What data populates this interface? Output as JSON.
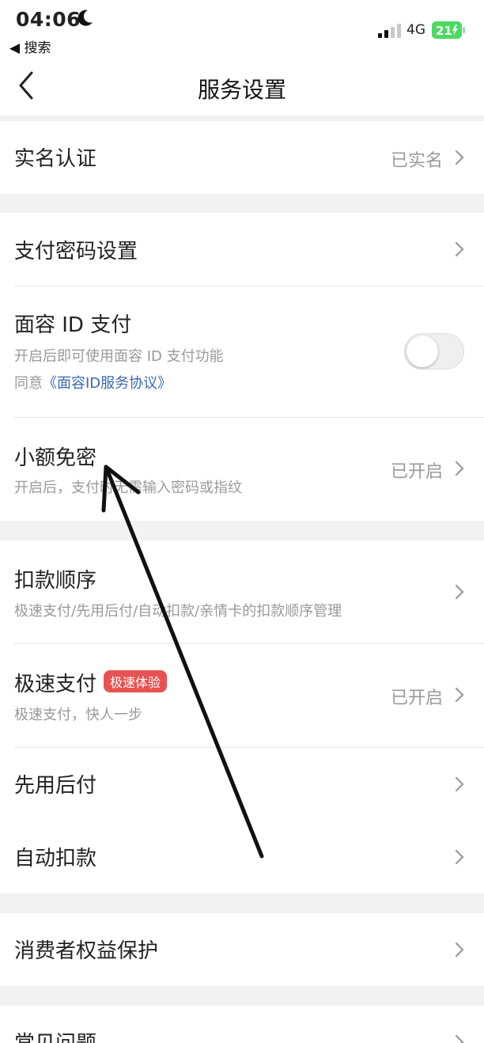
{
  "status_bar": {
    "time": "04:06",
    "back_app": "◀ 搜索",
    "network": "4G",
    "battery": "21"
  },
  "nav": {
    "title": "服务设置",
    "back_icon": "chevron-left-icon"
  },
  "items": {
    "real_name": {
      "title": "实名认证",
      "value": "已实名"
    },
    "pay_password": {
      "title": "支付密码设置"
    },
    "face_id": {
      "title": "面容 ID 支付",
      "subtitle": "开启后即可使用面容 ID 支付功能",
      "agree_prefix": "同意",
      "agreement_link": "《面容ID服务协议》",
      "toggle_on": false
    },
    "small_free": {
      "title": "小额免密",
      "subtitle": "开启后，支付时无需输入密码或指纹",
      "value": "已开启"
    },
    "deduct_order": {
      "title": "扣款顺序",
      "subtitle": "极速支付/先用后付/自动扣款/亲情卡的扣款顺序管理"
    },
    "fast_pay": {
      "title": "极速支付",
      "badge": "极速体验",
      "subtitle": "极速支付，快人一步",
      "value": "已开启"
    },
    "pay_later": {
      "title": "先用后付"
    },
    "auto_deduct": {
      "title": "自动扣款"
    },
    "consumer": {
      "title": "消费者权益保护"
    },
    "faq": {
      "title": "常见问题"
    }
  },
  "colors": {
    "link": "#3b68b3",
    "badge": "#e85252",
    "battery": "#4cd964"
  }
}
